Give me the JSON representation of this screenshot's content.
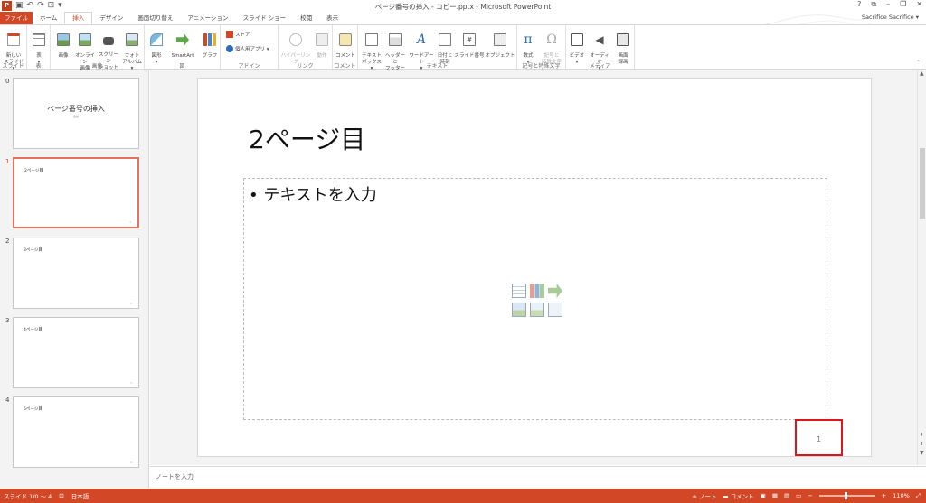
{
  "window": {
    "doc_title": "ページ番号の挿入 - コピー.pptx - Microsoft PowerPoint",
    "user": "Sacrifice Sacrifice",
    "controls": [
      "?",
      "⧉",
      "–",
      "❐",
      "✕"
    ]
  },
  "qat": {
    "undo": "↶",
    "redo": "↷",
    "start": "⊡"
  },
  "tabs": [
    "ファイル",
    "ホーム",
    "挿入",
    "デザイン",
    "画面切り替え",
    "アニメーション",
    "スライド ショー",
    "校閲",
    "表示"
  ],
  "active_tab": "挿入",
  "ribbon": {
    "groups": {
      "slides": "スライド",
      "table": "表",
      "images": "画像",
      "illust": "図",
      "apps": "アドイン",
      "links": "リンク",
      "comments": "コメント",
      "text": "テキスト",
      "symbols": "記号と特殊文字",
      "media": "メディア"
    },
    "buttons": {
      "new_slide": "新しい\nスライド ▾",
      "table": "表\n▾",
      "image": "画像",
      "online_image": "オンライン\n画像",
      "screenshot": "スクリーン\nショット ▾",
      "photo_album": "フォト\nアルバム ▾",
      "shapes": "図形\n▾",
      "smartart": "SmartArt",
      "chart": "グラフ",
      "store": "ストア",
      "my_apps": "個人用アプリ ▾",
      "hyperlink": "ハイパーリンク",
      "action": "動作",
      "comment": "コメント",
      "textbox": "テキスト\nボックス ▾",
      "header_footer": "ヘッダーと\nフッター",
      "wordart": "ワードアート\n▾",
      "date_time": "日付と\n時刻",
      "slide_number": "スライド番号",
      "object": "オブジェクト",
      "equation": "数式\n▾",
      "symbol": "記号と\n特殊文字",
      "video": "ビデオ\n▾",
      "audio": "オーディオ\n▾",
      "screen_record": "画面\n録画"
    }
  },
  "thumbnails": [
    {
      "num": "0",
      "big": "ページ番号の挿入",
      "sub": "名前",
      "title": "",
      "pn": ""
    },
    {
      "num": "1",
      "title": "2ページ目",
      "pn": "1"
    },
    {
      "num": "2",
      "title": "3ページ目",
      "pn": "2"
    },
    {
      "num": "3",
      "title": "4ページ目",
      "pn": "3"
    },
    {
      "num": "4",
      "title": "5ページ目",
      "pn": "4"
    }
  ],
  "slide": {
    "title": "2ページ目",
    "bullet": "• テキストを入力",
    "page_number": "1"
  },
  "notes_placeholder": "ノートを入力",
  "status": {
    "slide_info": "スライド 1/0 ～ 4",
    "language": "日本語",
    "notes": "≐ ノート",
    "comments": "コメント",
    "zoom": "110%",
    "zoom_minus": "−",
    "zoom_plus": "+"
  },
  "colors": {
    "accent": "#d24726",
    "highlight_box": "#e0151b"
  }
}
